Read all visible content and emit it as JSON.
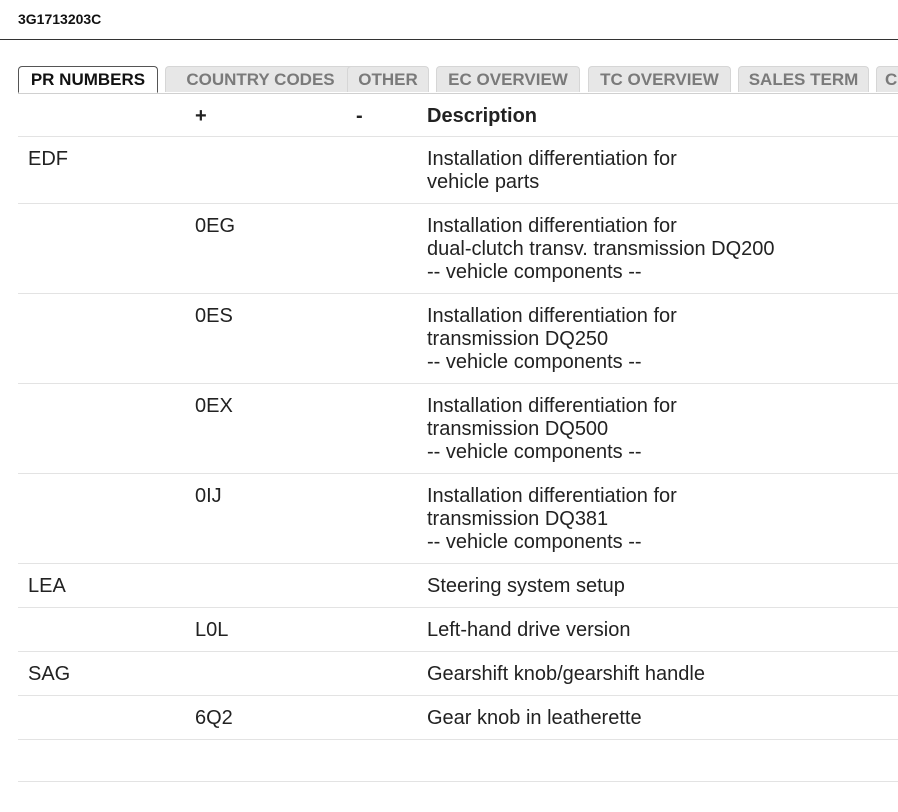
{
  "header": {
    "title": "3G1713203C"
  },
  "tabs": [
    {
      "label": "PR NUMBERS",
      "active": true
    },
    {
      "label": "COUNTRY CODES",
      "active": false
    },
    {
      "label": "OTHER",
      "active": false
    },
    {
      "label": "EC OVERVIEW",
      "active": false
    },
    {
      "label": "TC OVERVIEW",
      "active": false
    },
    {
      "label": "SALES TERM",
      "active": false
    },
    {
      "label": "C",
      "active": false
    }
  ],
  "table": {
    "columns": {
      "code": "",
      "plus": "+",
      "minus": "-",
      "description": "Description"
    },
    "rows": [
      {
        "code": "EDF",
        "plus": "",
        "minus": "",
        "desc": [
          "Installation differentiation for",
          "vehicle parts"
        ]
      },
      {
        "code": "",
        "plus": "0EG",
        "minus": "",
        "desc": [
          "Installation differentiation for",
          "dual-clutch transv. transmission DQ200",
          "-- vehicle components --"
        ]
      },
      {
        "code": "",
        "plus": "0ES",
        "minus": "",
        "desc": [
          "Installation differentiation for",
          "transmission DQ250",
          "-- vehicle components --"
        ]
      },
      {
        "code": "",
        "plus": "0EX",
        "minus": "",
        "desc": [
          "Installation differentiation for",
          "transmission DQ500",
          "-- vehicle components --"
        ]
      },
      {
        "code": "",
        "plus": "0IJ",
        "minus": "",
        "desc": [
          "Installation differentiation for",
          "transmission DQ381",
          "-- vehicle components --"
        ]
      },
      {
        "code": "LEA",
        "plus": "",
        "minus": "",
        "desc": [
          "Steering system setup"
        ]
      },
      {
        "code": "",
        "plus": "L0L",
        "minus": "",
        "desc": [
          "Left-hand drive version"
        ]
      },
      {
        "code": "SAG",
        "plus": "",
        "minus": "",
        "desc": [
          "Gearshift knob/gearshift handle"
        ]
      },
      {
        "code": "",
        "plus": "6Q2",
        "minus": "",
        "desc": [
          "Gear knob in leatherette"
        ]
      }
    ]
  }
}
